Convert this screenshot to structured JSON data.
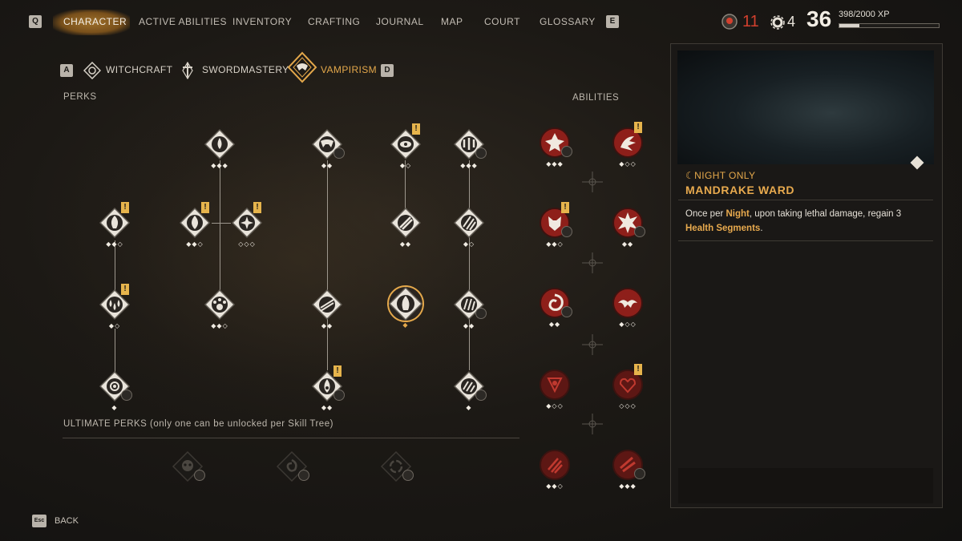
{
  "topbar": {
    "left_key": "Q",
    "right_key": "E",
    "nav": [
      {
        "label": "CHARACTER",
        "active": true
      },
      {
        "label": "ACTIVE ABILITIES",
        "active": false
      },
      {
        "label": "INVENTORY",
        "active": false
      },
      {
        "label": "CRAFTING",
        "active": false
      },
      {
        "label": "JOURNAL",
        "active": false
      },
      {
        "label": "MAP",
        "active": false
      },
      {
        "label": "COURT",
        "active": false
      },
      {
        "label": "GLOSSARY",
        "active": false
      }
    ],
    "red_stat": "11",
    "gear_stat": "4",
    "level": "36",
    "xp_text": "398/2000 XP",
    "xp_progress": 0.199
  },
  "trees": {
    "left_key": "A",
    "right_key": "D",
    "tabs": [
      {
        "label": "WITCHCRAFT",
        "active": false
      },
      {
        "label": "SWORDMASTERY",
        "active": false
      },
      {
        "label": "VAMPIRISM",
        "active": true
      }
    ]
  },
  "labels": {
    "perks": "PERKS",
    "abilities": "ABILITIES",
    "ultimate": "ULTIMATE PERKS (only one can be unlocked per Skill Tree)"
  },
  "perk_pips": {
    "n1": "◆◆◆",
    "n2": "◆◆",
    "n3": "◆◇",
    "n4": "◆◆◆",
    "n5": "◆◆◇",
    "n6": "◆◆◇",
    "n7": "◇◇◇",
    "n8": "◆◆",
    "n9": "◆◇",
    "n10": "◆◇",
    "n11": "◆◆◇",
    "n12": "◆◆",
    "n13": "◆",
    "n14": "◆◆",
    "n15": "◆",
    "n16": "◆◆",
    "n17": "◆",
    "n18": "◆"
  },
  "ability_pips": {
    "a1": "◆◆◆",
    "a2": "◆◇◇",
    "a3": "◆◆◇",
    "a4": "◆◆",
    "a5": "◆◆",
    "a6": "◆◇◇",
    "a7": "◆◇◇",
    "a8": "◇◇◇",
    "a9": "◆◆◇",
    "a10": "◆◆◆"
  },
  "panel": {
    "subtitle": "☾NIGHT ONLY",
    "title": "MANDRAKE WARD",
    "desc_1": "Once per ",
    "desc_night": "Night",
    "desc_2": ", upon taking lethal damage, regain 3",
    "desc_hs": "Health Segments",
    "desc_3": "."
  },
  "footer": {
    "key": "Esc",
    "back_label": "BACK"
  },
  "colors": {
    "accent": "#e8aa4e",
    "ability_red": "#8e1f1a",
    "alert_red": "#d2402e"
  }
}
